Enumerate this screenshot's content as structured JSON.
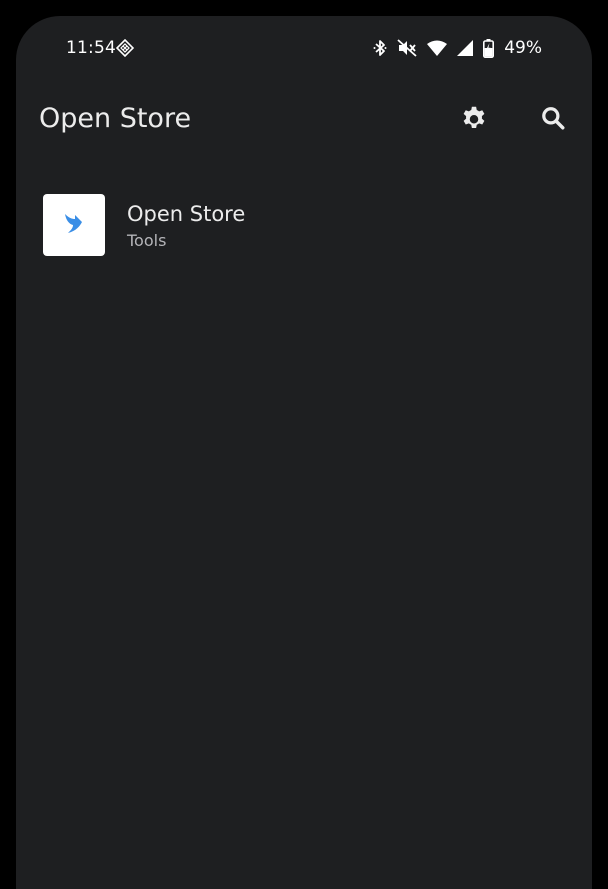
{
  "status_bar": {
    "time": "11:54",
    "app_icon": "diamond-grid-icon",
    "icons": [
      "bluetooth-icon",
      "vibrate-off-icon",
      "wifi-icon",
      "cell-signal-icon",
      "battery-charging-icon"
    ],
    "battery": "49%"
  },
  "app_bar": {
    "title": "Open Store",
    "actions": [
      "settings-icon",
      "search-icon"
    ]
  },
  "apps": [
    {
      "name": "Open Store",
      "category": "Tools",
      "icon": "bird-logo-icon",
      "icon_color": "#3a8ee6"
    }
  ],
  "colors": {
    "background": "#1e1f21",
    "text_primary": "#ececec",
    "text_secondary": "#b4b4b8",
    "accent": "#3a8ee6"
  }
}
